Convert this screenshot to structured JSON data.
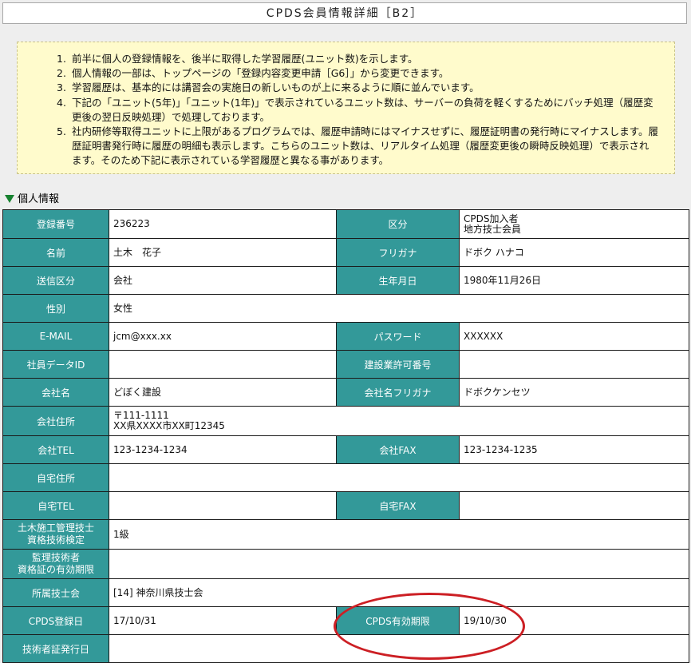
{
  "window": {
    "title": "CPDS会員情報詳細［B2］"
  },
  "notice": {
    "items": [
      {
        "num": "1.",
        "text": "前半に個人の登録情報を、後半に取得した学習履歴(ユニット数)を示します。"
      },
      {
        "num": "2.",
        "text": "個人情報の一部は、トップページの「登録内容変更申請［G6］」から変更できます。"
      },
      {
        "num": "3.",
        "text": "学習履歴は、基本的には講習会の実施日の新しいものが上に来るように順に並んでいます。"
      },
      {
        "num": "4.",
        "text": "下記の「ユニット(5年)」「ユニット(1年)」で表示されているユニット数は、サーバーの負荷を軽くするためにバッチ処理（履歴変更後の翌日反映処理）で処理しております。"
      },
      {
        "num": "5.",
        "text": "社内研修等取得ユニットに上限があるプログラムでは、履歴申請時にはマイナスせずに、履歴証明書の発行時にマイナスします。履歴証明書発行時に履歴の明細も表示します。こちらのユニット数は、リアルタイム処理（履歴変更後の瞬時反映処理）で表示されます。そのため下記に表示されている学習履歴と異なる事があります。"
      }
    ]
  },
  "section": {
    "title": "個人情報"
  },
  "fields": {
    "reg_no": {
      "label": "登録番号",
      "value": "236223"
    },
    "category": {
      "label": "区分",
      "value_1": "CPDS加入者",
      "value_2": "地方技士会員"
    },
    "name": {
      "label": "名前",
      "value": "土木　花子"
    },
    "furigana": {
      "label": "フリガナ",
      "value": "ドボク ハナコ"
    },
    "send_cat": {
      "label": "送信区分",
      "value": "会社"
    },
    "birthdate": {
      "label": "生年月日",
      "value": "1980年11月26日"
    },
    "gender": {
      "label": "性別",
      "value": "女性"
    },
    "email": {
      "label": "E-MAIL",
      "value": "jcm@xxx.xx"
    },
    "password": {
      "label": "パスワード",
      "value": "XXXXXX"
    },
    "employee_id": {
      "label": "社員データID",
      "value": ""
    },
    "permit_no": {
      "label": "建設業許可番号",
      "value": ""
    },
    "company": {
      "label": "会社名",
      "value": "どぼく建設"
    },
    "company_kana": {
      "label": "会社名フリガナ",
      "value": "ドボクケンセツ"
    },
    "company_addr": {
      "label": "会社住所",
      "value_1": "〒111-1111",
      "value_2": "XX県XXXX市XX町12345"
    },
    "company_tel": {
      "label": "会社TEL",
      "value": "123-1234-1234"
    },
    "company_fax": {
      "label": "会社FAX",
      "value": "123-1234-1235"
    },
    "home_addr": {
      "label": "自宅住所",
      "value": ""
    },
    "home_tel": {
      "label": "自宅TEL",
      "value": ""
    },
    "home_fax": {
      "label": "自宅FAX",
      "value": ""
    },
    "qual": {
      "label_1": "土木施工管理技士",
      "label_2": "資格技術検定",
      "value": "1級"
    },
    "supervisor": {
      "label_1": "監理技術者",
      "label_2": "資格証の有効期限",
      "value": ""
    },
    "association": {
      "label": "所属技士会",
      "value": "[14] 神奈川県技士会"
    },
    "cpds_reg": {
      "label": "CPDS登録日",
      "value": "17/10/31"
    },
    "cpds_expire": {
      "label": "CPDS有効期限",
      "value": "19/10/30"
    },
    "cert_issue": {
      "label": "技術者証発行日",
      "value": ""
    }
  },
  "colors": {
    "label_bg": "#339999",
    "notice_bg": "#fffbcc",
    "highlight_oval": "#cc1f24",
    "section_triangle": "#16812f"
  }
}
